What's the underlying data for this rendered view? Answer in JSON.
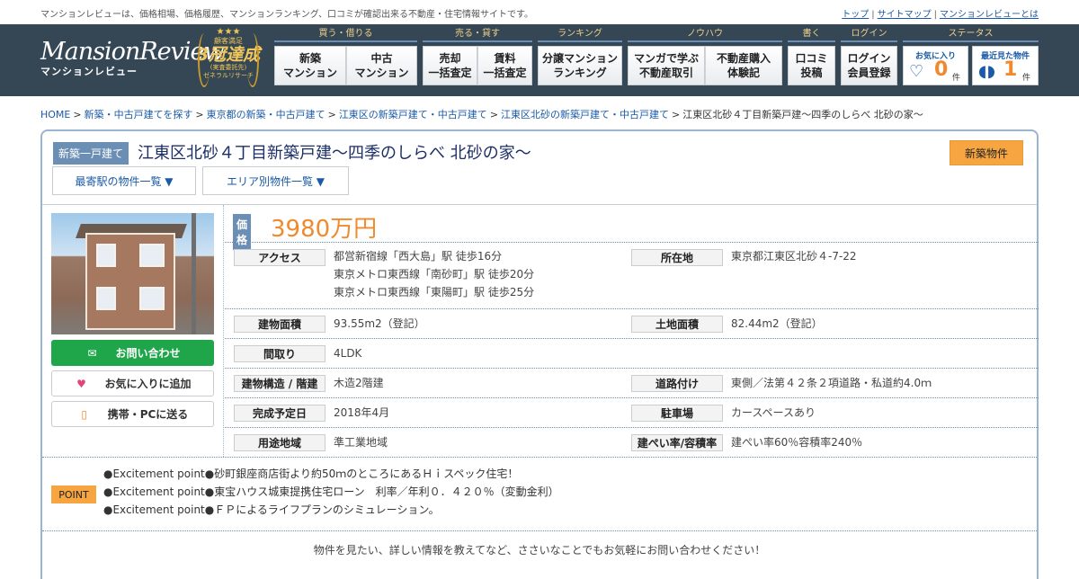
{
  "topbar": {
    "tagline": "マンションレビューは、価格相場、価格履歴、マンションランキング、口コミが確認出来る不動産・住宅情報サイトです。",
    "links": [
      "トップ",
      "サイトマップ",
      "マンションレビューとは"
    ]
  },
  "logo": {
    "en": "MansionReview",
    "jp": "マンションレビュー"
  },
  "award": {
    "stars": "★★★",
    "line1": "顧客満足",
    "big": "3冠達成",
    "line3": "(実査委託先)",
    "line4": "ゼネラルリサーチ"
  },
  "nav": {
    "groups": [
      {
        "title": "買う・借りる",
        "buttons": [
          [
            "新築",
            "マンション"
          ],
          [
            "中古",
            "マンション"
          ]
        ]
      },
      {
        "title": "売る・貸す",
        "buttons": [
          [
            "売却",
            "一括査定"
          ],
          [
            "賃料",
            "一括査定"
          ]
        ]
      },
      {
        "title": "ランキング",
        "buttons": [
          [
            "分譲マンション",
            "ランキング"
          ]
        ]
      },
      {
        "title": "ノウハウ",
        "buttons": [
          [
            "マンガで学ぶ",
            "不動産取引"
          ],
          [
            "不動産購入",
            "体験記"
          ]
        ]
      },
      {
        "title": "書く",
        "buttons": [
          [
            "口コミ",
            "投稿"
          ]
        ]
      },
      {
        "title": "ログイン",
        "buttons": [
          [
            "ログイン",
            "会員登録"
          ]
        ]
      }
    ],
    "status_title": "ステータス",
    "favorites": {
      "label": "お気に入り",
      "count": "0",
      "unit": "件"
    },
    "recent": {
      "label": "最近見た物件",
      "count": "1",
      "unit": "件"
    }
  },
  "breadcrumb": [
    "HOME",
    "新築・中古戸建てを探す",
    "東京都の新築・中古戸建て",
    "江東区の新築戸建て・中古戸建て",
    "江東区北砂の新築戸建て・中古戸建て",
    "江東区北砂４丁目新築戸建～四季のしらべ 北砂の家～"
  ],
  "property": {
    "type_badge": "新築一戸建て",
    "title": "江東区北砂４丁目新築戸建～四季のしらべ 北砂の家～",
    "new_badge": "新築物件",
    "nearest_station_btn": "最寄駅の物件一覧 ▼",
    "area_btn": "エリア別物件一覧 ▼",
    "price_label": "価格",
    "price": "3980万円"
  },
  "sidebar": {
    "contact": "お問い合わせ",
    "favorite": "お気に入りに追加",
    "send": "携帯・PCに送る"
  },
  "specs": {
    "access_label": "アクセス",
    "access": [
      "都営新宿線「西大島」駅 徒歩16分",
      "東京メトロ東西線「南砂町」駅 徒歩20分",
      "東京メトロ東西線「東陽町」駅 徒歩25分"
    ],
    "address_label": "所在地",
    "address": "東京都江東区北砂４-7-22",
    "building_area_label": "建物面積",
    "building_area": "93.55m2（登記）",
    "land_area_label": "土地面積",
    "land_area": "82.44m2（登記）",
    "layout_label": "間取り",
    "layout": "4LDK",
    "structure_label": "建物構造 / 階建",
    "structure": "木造2階建",
    "road_label": "道路付け",
    "road": "東側／法第４２条２項道路・私道約4.0ｍ",
    "completion_label": "完成予定日",
    "completion": "2018年4月",
    "parking_label": "駐車場",
    "parking": "カースペースあり",
    "zoning_label": "用途地域",
    "zoning": "準工業地域",
    "ratio_label": "建ぺい率/容積率",
    "ratio": "建ぺい率60％容積率240％"
  },
  "points": {
    "badge": "POINT",
    "lines": [
      "●Excitement point●砂町銀座商店街より約50ｍのところにあるＨｉスペック住宅！",
      "●Excitement point●東宝ハウス城東提携住宅ローン　利率／年利０．４２０％（変動金利）",
      "●Excitement point●ＦＰによるライフプランのシミュレーション。"
    ]
  },
  "contact_msg": "物件を見たい、詳しい情報を教えてなど、ささいなことでもお気軽にお問い合わせください！",
  "colors": {
    "header_bg": "#354655",
    "accent_orange": "#f08a2c",
    "link_blue": "#1a5aa6",
    "green": "#1fa64a"
  }
}
